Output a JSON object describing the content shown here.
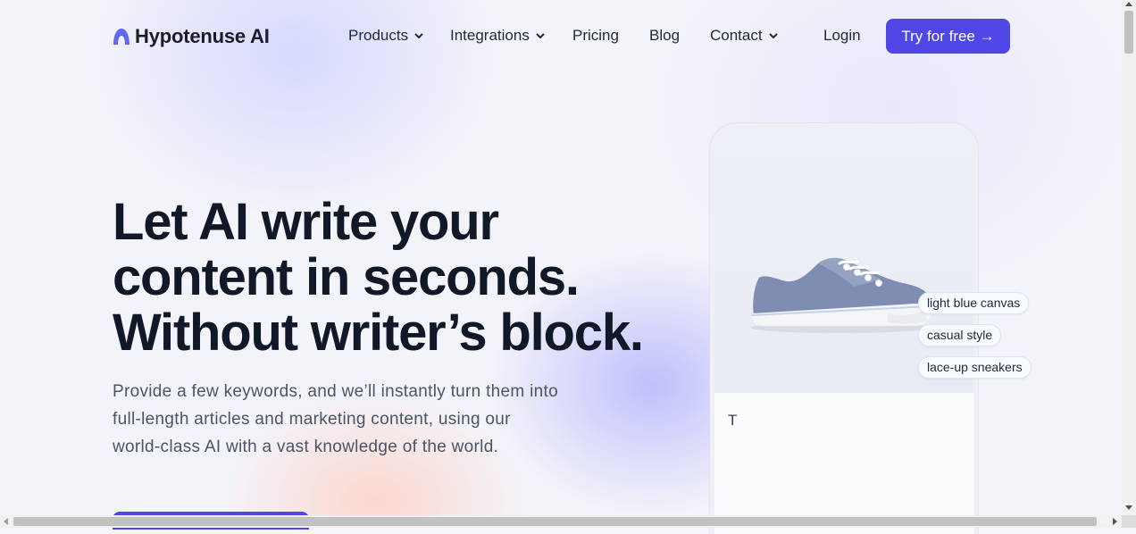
{
  "brand": {
    "name": "Hypotenuse AI",
    "logo_icon": "hypotenuse-logo-icon",
    "accent_color": "#4f46e5"
  },
  "nav": {
    "items": [
      {
        "label": "Products",
        "has_dropdown": true
      },
      {
        "label": "Integrations",
        "has_dropdown": true
      },
      {
        "label": "Pricing",
        "has_dropdown": false
      },
      {
        "label": "Blog",
        "has_dropdown": false
      },
      {
        "label": "Contact",
        "has_dropdown": true
      }
    ],
    "login_label": "Login",
    "cta_label": "Try for free →"
  },
  "hero": {
    "headline": "Let AI write your content in seconds. Without writer’s block.",
    "subheadline": "Provide a few keywords, and we’ll instantly turn them into full-length articles and marketing content, using our world-class AI with a vast knowledge of the world."
  },
  "demo": {
    "product_image": "blue-canvas-sneaker-image",
    "keywords": [
      "light blue canvas",
      "casual style",
      "lace-up sneakers"
    ],
    "typed_text": "T"
  }
}
